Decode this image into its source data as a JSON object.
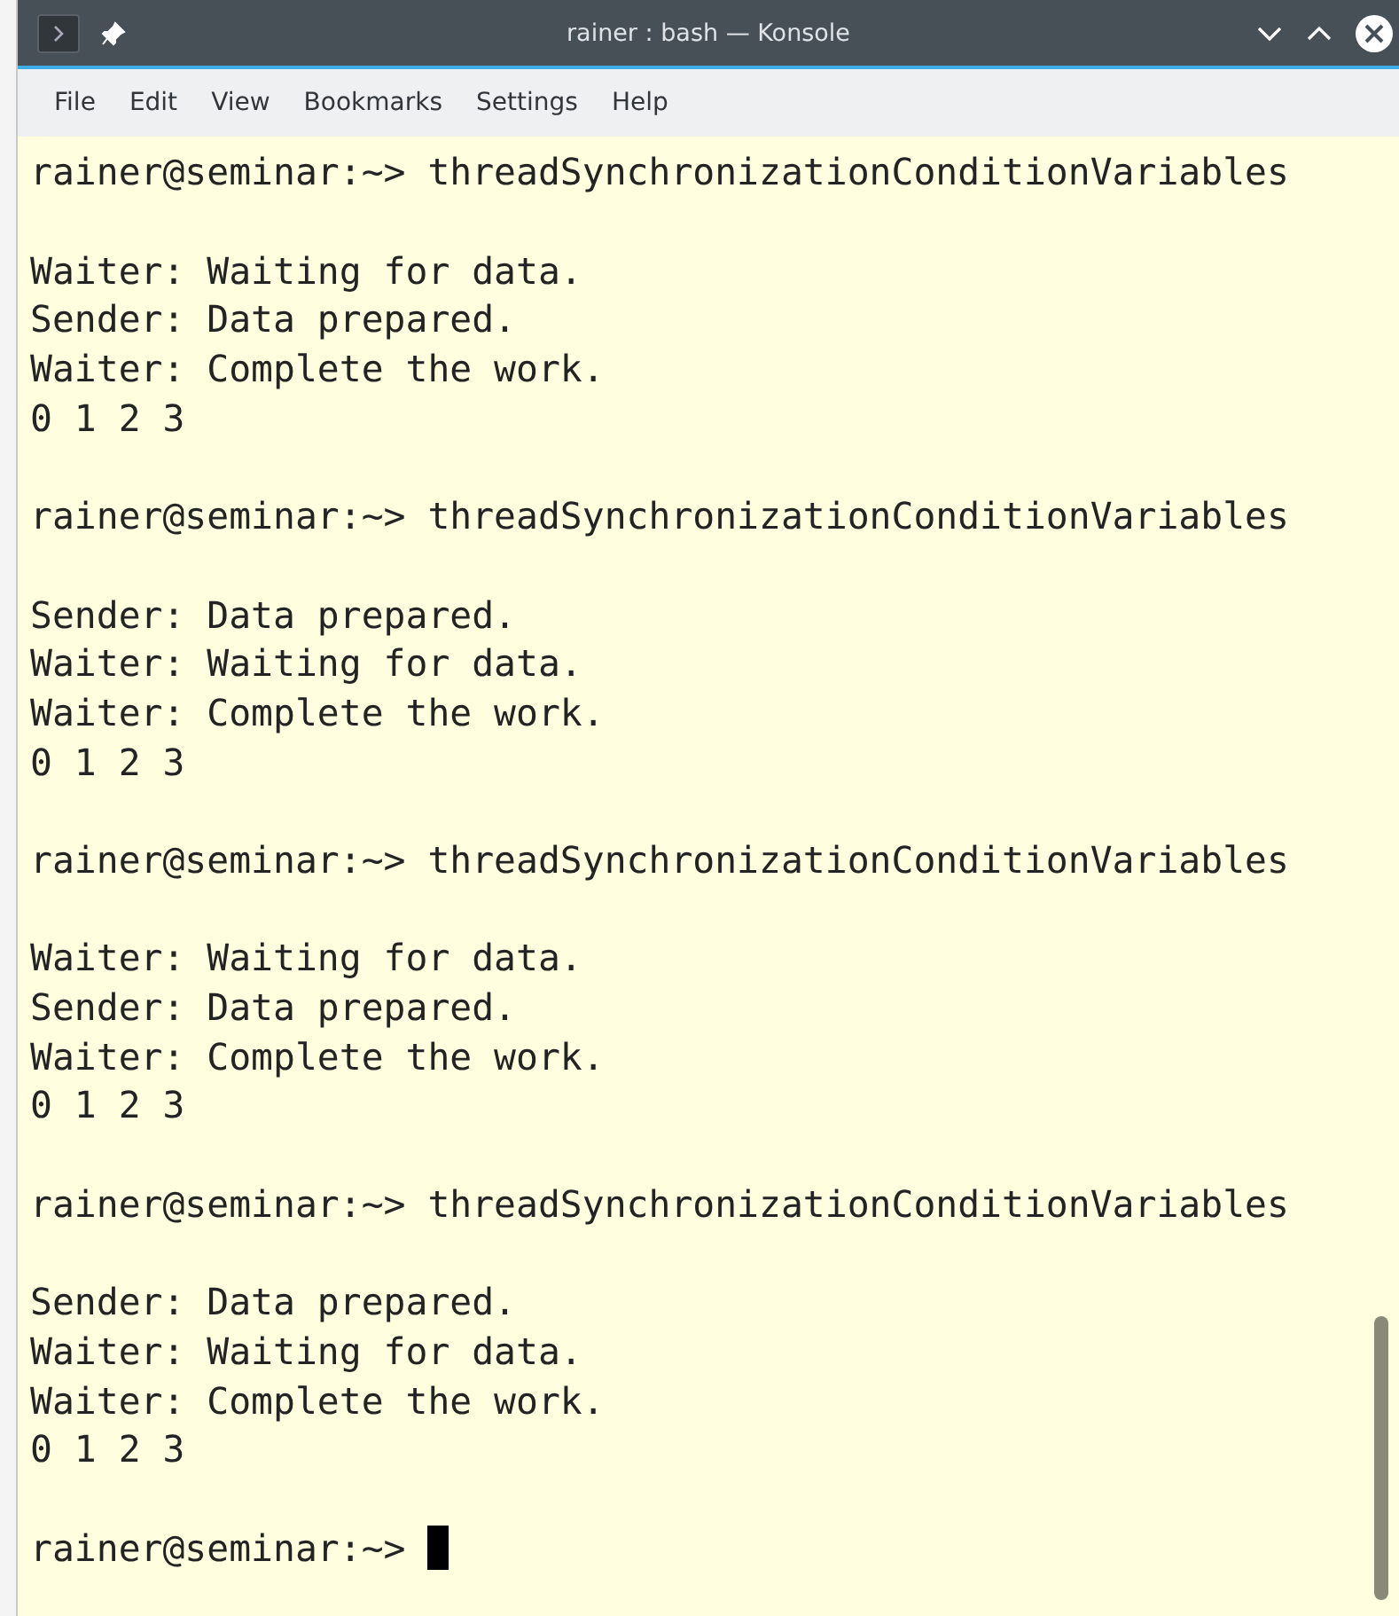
{
  "window": {
    "title": "rainer : bash — Konsole"
  },
  "menu": [
    "File",
    "Edit",
    "View",
    "Bookmarks",
    "Settings",
    "Help"
  ],
  "terminal": {
    "runs": [
      {
        "command_line": "rainer@seminar:~> threadSynchronizationConditionVariables",
        "output": [
          "Waiter: Waiting for data.",
          "Sender: Data prepared.",
          "Waiter: Complete the work.",
          "0 1 2 3"
        ]
      },
      {
        "command_line": "rainer@seminar:~> threadSynchronizationConditionVariables",
        "output": [
          "Sender: Data prepared.",
          "Waiter: Waiting for data.",
          "Waiter: Complete the work.",
          "0 1 2 3"
        ]
      },
      {
        "command_line": "rainer@seminar:~> threadSynchronizationConditionVariables",
        "output": [
          "Waiter: Waiting for data.",
          "Sender: Data prepared.",
          "Waiter: Complete the work.",
          "0 1 2 3"
        ]
      },
      {
        "command_line": "rainer@seminar:~> threadSynchronizationConditionVariables",
        "output": [
          "Sender: Data prepared.",
          "Waiter: Waiting for data.",
          "Waiter: Complete the work.",
          "0 1 2 3"
        ]
      }
    ],
    "prompt": "rainer@seminar:~>"
  }
}
